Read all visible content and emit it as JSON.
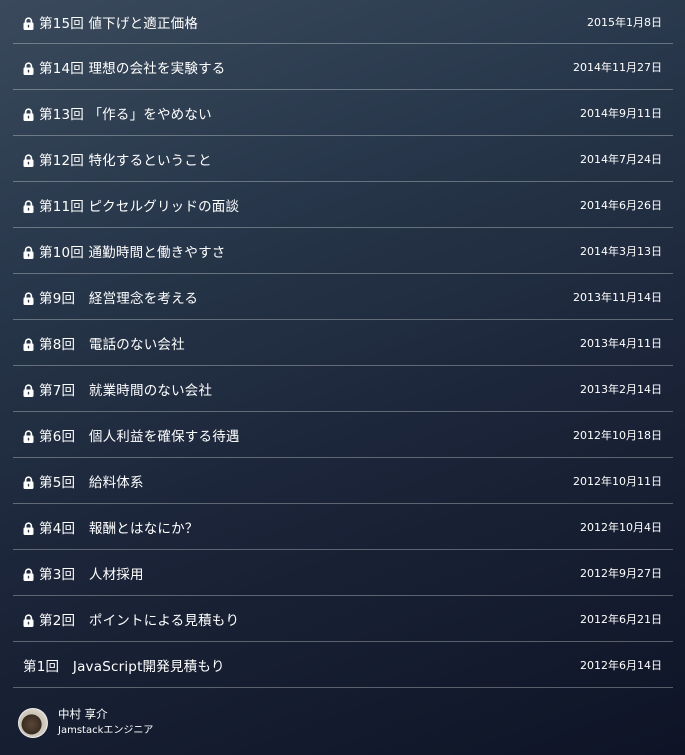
{
  "entries": [
    {
      "title": "第15回 値下げと適正価格",
      "date": "2015年1月8日",
      "locked": true
    },
    {
      "title": "第14回 理想の会社を実験する",
      "date": "2014年11月27日",
      "locked": true
    },
    {
      "title": "第13回 「作る」をやめない",
      "date": "2014年9月11日",
      "locked": true
    },
    {
      "title": "第12回 特化するということ",
      "date": "2014年7月24日",
      "locked": true
    },
    {
      "title": "第11回 ピクセルグリッドの面談",
      "date": "2014年6月26日",
      "locked": true
    },
    {
      "title": "第10回 通勤時間と働きやすさ",
      "date": "2014年3月13日",
      "locked": true
    },
    {
      "title": "第9回　経営理念を考える",
      "date": "2013年11月14日",
      "locked": true
    },
    {
      "title": "第8回　電話のない会社",
      "date": "2013年4月11日",
      "locked": true
    },
    {
      "title": "第7回　就業時間のない会社",
      "date": "2013年2月14日",
      "locked": true
    },
    {
      "title": "第6回　個人利益を確保する待遇",
      "date": "2012年10月18日",
      "locked": true
    },
    {
      "title": "第5回　給料体系",
      "date": "2012年10月11日",
      "locked": true
    },
    {
      "title": "第4回　報酬とはなにか？",
      "date": "2012年10月4日",
      "locked": true
    },
    {
      "title": "第3回　人材採用",
      "date": "2012年9月27日",
      "locked": true
    },
    {
      "title": "第2回　ポイントによる見積もり",
      "date": "2012年6月21日",
      "locked": true
    },
    {
      "title": "第1回　JavaScript開発見積もり",
      "date": "2012年6月14日",
      "locked": false
    }
  ],
  "author": {
    "name": "中村 享介",
    "role": "Jamstackエンジニア"
  },
  "icons": {
    "lock": "lock-icon"
  }
}
